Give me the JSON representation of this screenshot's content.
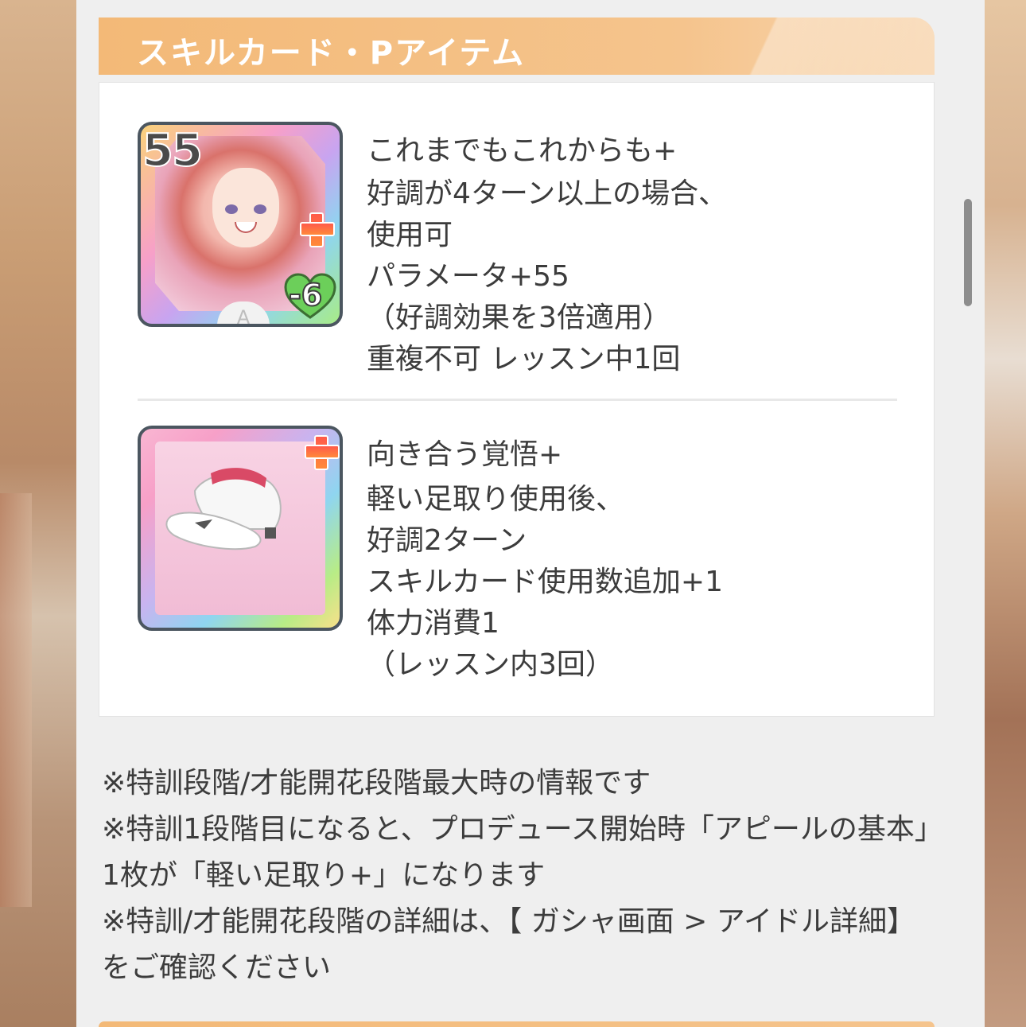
{
  "section": {
    "title": "スキルカード・Pアイテム"
  },
  "items": [
    {
      "cost": "55",
      "stamina": "-6",
      "rarity": "A",
      "name": "これまでもこれからも+",
      "description": [
        "好調が4ターン以上の場合、",
        "使用可",
        "パラメータ+55",
        "（好調効果を3倍適用）",
        "重複不可 レッスン中1回"
      ]
    },
    {
      "name": "向き合う覚悟+",
      "description": [
        "軽い足取り使用後、",
        "好調2ターン",
        "スキルカード使用数追加+1",
        "体力消費1",
        "（レッスン内3回）"
      ]
    }
  ],
  "notes": [
    "※特訓段階/才能開花段階最大時の情報です",
    "※特訓1段階目になると、プロデュース開始時「アピールの基本」1枚が「軽い足取り+」になります",
    "※特訓/才能開花段階の詳細は、【 ガシャ画面 > アイドル詳細】をご確認ください"
  ],
  "colors": {
    "header_orange": "#f3b977",
    "text": "#3c3c3c",
    "panel_bg": "#efefef"
  }
}
